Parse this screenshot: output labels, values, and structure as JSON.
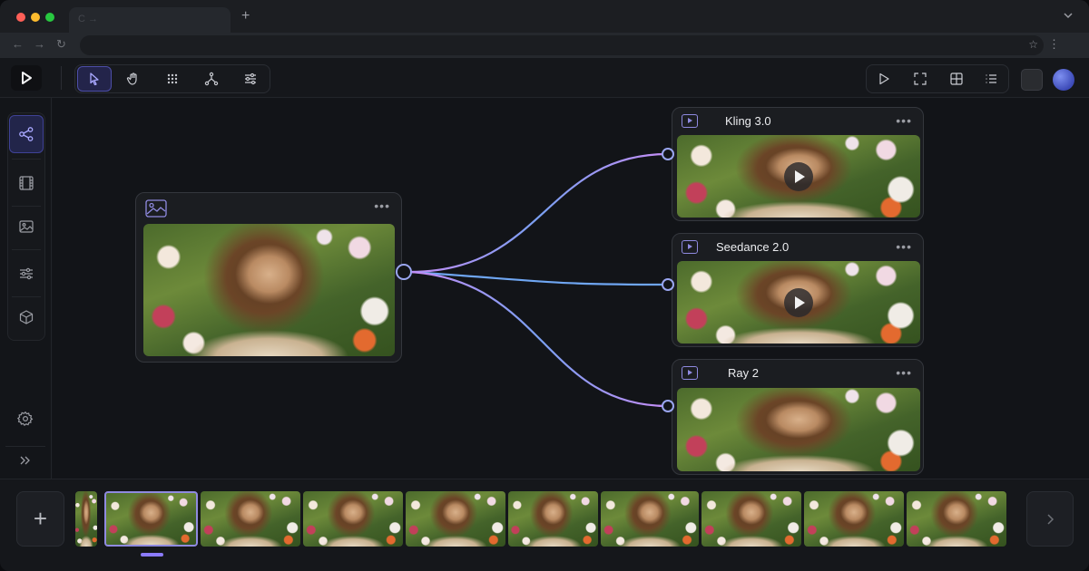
{
  "browser": {
    "tab_ghost": "C  →",
    "new_tab_glyph": "+",
    "back_glyph": "←",
    "forward_glyph": "→",
    "reload_glyph": "↻",
    "star_glyph": "☆",
    "menu_glyph": "⋮"
  },
  "toolbar": {
    "tools": [
      "select-pointer-icon",
      "hand-pan-icon",
      "grid-dots-icon",
      "node-branch-icon",
      "sliders-icon"
    ],
    "active_tool": "select-pointer-icon",
    "right_tools": [
      "play-icon",
      "fullscreen-icon",
      "layout-grid-icon",
      "list-icon"
    ]
  },
  "sidebar": {
    "items": [
      "workflow-nodes-icon",
      "film-icon",
      "image-icon",
      "adjustments-icon",
      "cube-icon"
    ],
    "active_item": "workflow-nodes-icon",
    "bottom": [
      "settings-icon",
      "expand-icon"
    ]
  },
  "canvas": {
    "source_node": {
      "menu": "•••",
      "icon": "image-icon"
    },
    "outputs": [
      {
        "title": "Kling 3.0",
        "menu": "•••",
        "has_play": true
      },
      {
        "title": "Seedance 2.0",
        "menu": "•••",
        "has_play": true
      },
      {
        "title": "Ray 2",
        "menu": "•••",
        "has_play": false
      }
    ]
  },
  "filmstrip": {
    "add_label": "+",
    "frame_count": 10,
    "selected_frame": 1,
    "next_icon": "chevron-right-icon"
  },
  "colors": {
    "accent": "#8b7bff",
    "link_start": "#c58cf5",
    "link_end": "#5fa8f0"
  }
}
